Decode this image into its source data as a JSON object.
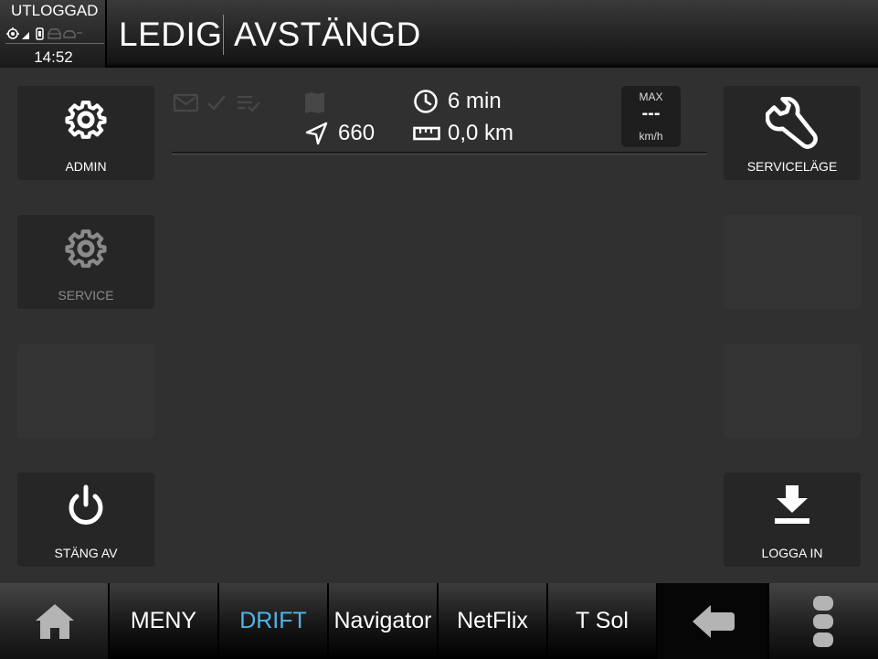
{
  "status": {
    "login": "UTLOGGAD",
    "time": "14:52",
    "icons": [
      "gps-icon",
      "signal-icon",
      "phone-icon",
      "car-icon",
      "car-signal-icon"
    ]
  },
  "header": {
    "title": "LEDIG",
    "subtitle": "AVSTÄNGD"
  },
  "left_buttons": {
    "admin": {
      "label": "ADMIN",
      "icon": "gear-icon"
    },
    "service": {
      "label": "SERVICE",
      "icon": "gear-icon"
    },
    "power_off": {
      "label": "STÄNG AV",
      "icon": "power-icon"
    }
  },
  "right_buttons": {
    "service_mode": {
      "label": "SERVICELÄGE",
      "icon": "wrench-icon"
    },
    "login": {
      "label": "LOGGA IN",
      "icon": "download-icon"
    }
  },
  "trip": {
    "nav_value": "660",
    "time_value": "6 min",
    "distance_value": "0,0 km",
    "max": {
      "title": "MAX",
      "value": "---",
      "unit": "km/h"
    }
  },
  "nav": {
    "tabs": [
      {
        "label": "MENY"
      },
      {
        "label": "DRIFT",
        "active": true
      },
      {
        "label": "Navigator"
      },
      {
        "label": "NetFlix"
      },
      {
        "label": "T Sol"
      }
    ]
  },
  "colors": {
    "background": "#303030",
    "button": "#262626",
    "active_tab": "#52b4e8"
  }
}
